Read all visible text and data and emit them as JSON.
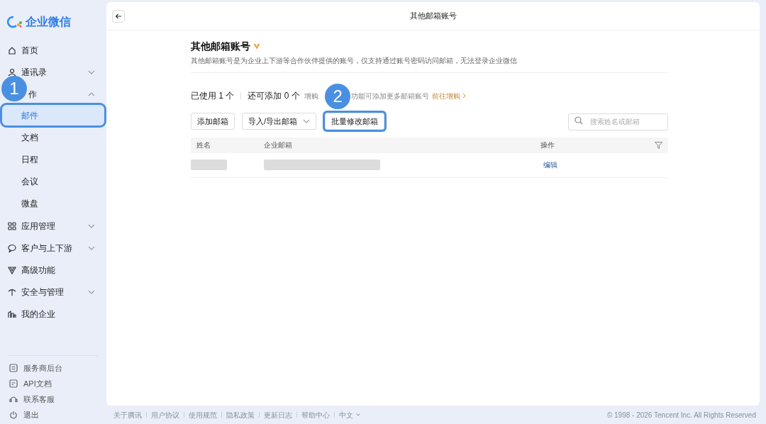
{
  "brand": "企业微信",
  "sidebar": {
    "items": [
      {
        "label": "首页"
      },
      {
        "label": "通讯录",
        "expanded": false
      },
      {
        "label": "作",
        "expanded": true,
        "children": [
          {
            "label": "邮件",
            "selected": true,
            "callout": "1"
          },
          {
            "label": "文档",
            "selected": false
          },
          {
            "label": "日程",
            "selected": false
          },
          {
            "label": "会议",
            "selected": false
          },
          {
            "label": "微盘",
            "selected": false
          }
        ]
      },
      {
        "label": "应用管理",
        "expanded": false
      },
      {
        "label": "客户与上下游",
        "expanded": false
      },
      {
        "label": "高级功能"
      },
      {
        "label": "安全与管理",
        "expanded": false
      },
      {
        "label": "我的企业"
      }
    ],
    "bottom": [
      {
        "label": "服务商后台"
      },
      {
        "label": "API文档"
      },
      {
        "label": "联系客服"
      },
      {
        "label": "退出"
      }
    ]
  },
  "header": {
    "title": "其他邮箱账号"
  },
  "section": {
    "title": "其他邮箱账号",
    "description": "其他邮箱账号是为企业上下游等合作伙伴提供的账号，仅支持通过账号密码访问邮箱，无法登录企业微信"
  },
  "stats": {
    "used": "已使用 1 个",
    "remaining": "还可添加 0 个",
    "hint_start": "增购",
    "hint_end": "功能可添加更多邮箱账号",
    "link": "前往增购"
  },
  "toolbar": {
    "buttons": [
      {
        "label": "添加邮箱",
        "dropdown": false
      },
      {
        "label": "导入/导出邮箱",
        "dropdown": true
      },
      {
        "label": "批量修改邮箱",
        "dropdown": false,
        "callout": "2"
      }
    ],
    "search_placeholder": "搜索姓名或邮箱"
  },
  "table": {
    "columns": [
      "姓名",
      "企业邮箱",
      "操作"
    ],
    "rows": [
      {
        "redacted": true,
        "action": "编辑"
      }
    ]
  },
  "footer": {
    "links": [
      "关于腾讯",
      "用户协议",
      "使用规范",
      "隐私政策",
      "更新日志",
      "帮助中心"
    ],
    "language": "中文",
    "copyright": "© 1998 - 2026 Tencent Inc. All Rights Reserved"
  }
}
